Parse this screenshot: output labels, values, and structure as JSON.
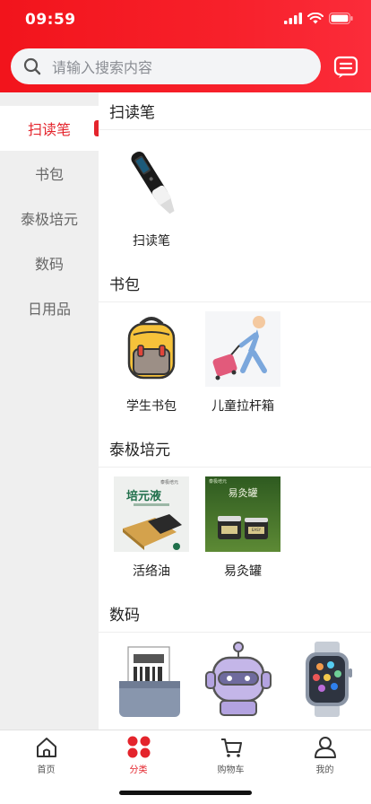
{
  "status_bar": {
    "time": "09:59"
  },
  "search": {
    "placeholder": "请输入搜索内容"
  },
  "sidebar": {
    "items": [
      {
        "label": "扫读笔",
        "active": true
      },
      {
        "label": "书包"
      },
      {
        "label": "泰极培元"
      },
      {
        "label": "数码"
      },
      {
        "label": "日用品"
      }
    ]
  },
  "sections": [
    {
      "title": "扫读笔",
      "items": [
        {
          "label": "扫读笔",
          "icon": "scan-pen-image"
        }
      ]
    },
    {
      "title": "书包",
      "items": [
        {
          "label": "学生书包",
          "icon": "school-bag-image"
        },
        {
          "label": "儿童拉杆箱",
          "icon": "trolley-case-image"
        }
      ]
    },
    {
      "title": "泰极培元",
      "items": [
        {
          "label": "活络油",
          "icon": "medicated-oil-image",
          "image_text": {
            "brand": "泰极培元",
            "name": "培元液"
          }
        },
        {
          "label": "易灸罐",
          "icon": "moxibustion-jar-image",
          "image_text": {
            "brand": "泰极培元",
            "name": "易灸罐",
            "jar": "EASY"
          }
        }
      ]
    },
    {
      "title": "数码",
      "items": [
        {
          "label": "",
          "icon": "printer-image"
        },
        {
          "label": "",
          "icon": "robot-image"
        },
        {
          "label": "",
          "icon": "smartwatch-image"
        }
      ]
    }
  ],
  "tabbar": {
    "tabs": [
      {
        "label": "首页",
        "icon": "home-icon"
      },
      {
        "label": "分类",
        "icon": "category-icon",
        "active": true
      },
      {
        "label": "购物车",
        "icon": "cart-icon"
      },
      {
        "label": "我的",
        "icon": "user-icon"
      }
    ]
  },
  "colors": {
    "accent": "#e4242c",
    "header": "#f2141c",
    "sidebar_bg": "#efefef"
  }
}
